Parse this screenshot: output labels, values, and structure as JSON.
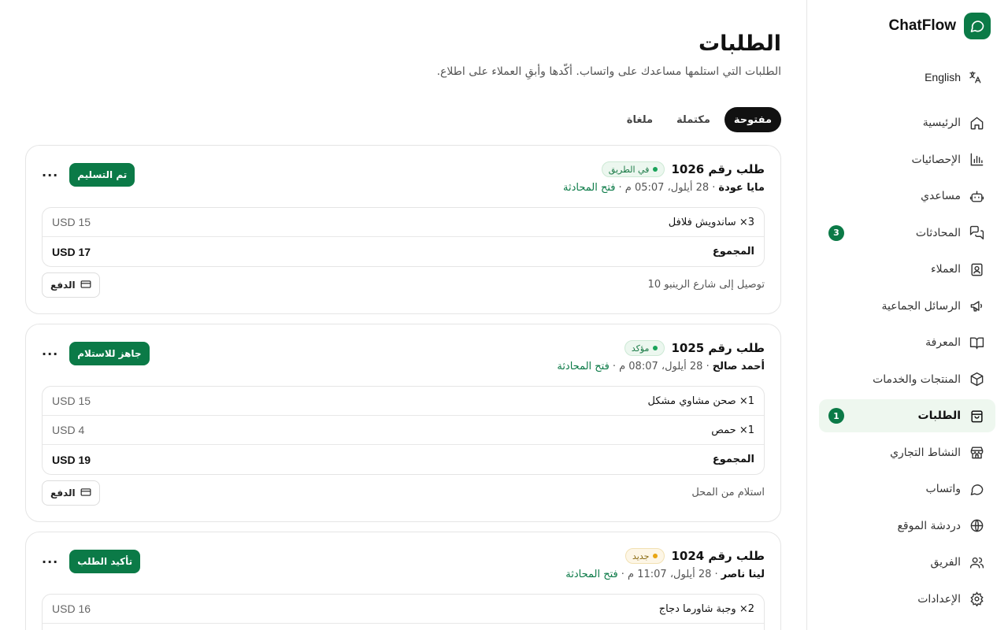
{
  "brand": {
    "name": "ChatFlow"
  },
  "lang": {
    "label": "English"
  },
  "nav": [
    {
      "label": "الرئيسية",
      "icon": "home-icon"
    },
    {
      "label": "الإحصائيات",
      "icon": "bar-chart-icon"
    },
    {
      "label": "مساعدي",
      "icon": "bot-icon"
    },
    {
      "label": "المحادثات",
      "icon": "chat-icon",
      "badge": "3"
    },
    {
      "label": "العملاء",
      "icon": "contacts-icon"
    },
    {
      "label": "الرسائل الجماعية",
      "icon": "megaphone-icon"
    },
    {
      "label": "المعرفة",
      "icon": "book-icon"
    },
    {
      "label": "المنتجات والخدمات",
      "icon": "box-icon"
    },
    {
      "label": "الطلبات",
      "icon": "shopping-bag-icon",
      "badge": "1",
      "active": true
    },
    {
      "label": "النشاط التجاري",
      "icon": "store-icon"
    },
    {
      "label": "واتساب",
      "icon": "whatsapp-icon"
    },
    {
      "label": "دردشة الموقع",
      "icon": "globe-icon"
    },
    {
      "label": "الفريق",
      "icon": "team-icon"
    },
    {
      "label": "الإعدادات",
      "icon": "gear-icon"
    }
  ],
  "page": {
    "title": "الطلبات",
    "subtitle": "الطلبات التي استلمها مساعدك على واتساب. أكّدها وأبقِ العملاء على اطلاع."
  },
  "tabs": [
    {
      "label": "مفتوحة",
      "active": true
    },
    {
      "label": "مكتملة"
    },
    {
      "label": "ملغاة"
    }
  ],
  "orders": [
    {
      "title": "طلب رقم 1026",
      "status": "في الطريق",
      "status_color": "#1aa35a",
      "customer": "مايا عودة",
      "datetime": "· 28 أيلول، 05:07 م ·",
      "open_chat": "فتح المحادثة",
      "action": "تم التسليم",
      "more": "···",
      "items": [
        {
          "name": "3× ساندويش فلافل",
          "price": "USD 15"
        }
      ],
      "total_label": "المجموع",
      "total": "USD 17",
      "delivery": "توصيل إلى شارع الرينبو 10",
      "pay": "الدفع"
    },
    {
      "title": "طلب رقم 1025",
      "status": "مؤكد",
      "status_color": "#1aa35a",
      "customer": "أحمد صالح",
      "datetime": "· 28 أيلول، 08:07 م ·",
      "open_chat": "فتح المحادثة",
      "action": "جاهز للاستلام",
      "more": "···",
      "items": [
        {
          "name": "1× صحن مشاوي مشكل",
          "price": "USD 15"
        },
        {
          "name": "1× حمص",
          "price": "USD 4"
        }
      ],
      "total_label": "المجموع",
      "total": "USD 19",
      "delivery": "استلام من المحل",
      "pay": "الدفع"
    },
    {
      "title": "طلب رقم 1024",
      "status": "جديد",
      "status_color": "#e8a512",
      "customer": "لينا ناصر",
      "datetime": "· 28 أيلول، 11:07 م ·",
      "open_chat": "فتح المحادثة",
      "action": "تأكيد الطلب",
      "more": "···",
      "items": [
        {
          "name": "2× وجبة شاورما دجاج",
          "price": "USD 16"
        }
      ]
    }
  ]
}
